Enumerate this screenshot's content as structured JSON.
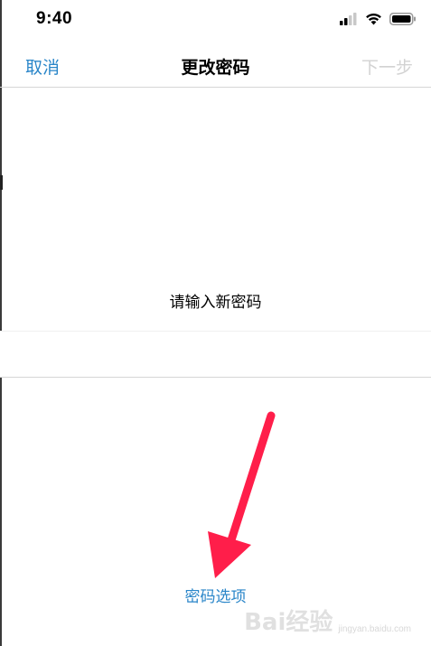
{
  "status_bar": {
    "time": "9:40",
    "icons": [
      "cellular-signal-icon",
      "wifi-icon",
      "battery-icon"
    ]
  },
  "nav": {
    "cancel_label": "取消",
    "title": "更改密码",
    "next_label": "下一步"
  },
  "prompt": "请输入新密码",
  "password_field": {
    "value": ""
  },
  "options_link": "密码选项",
  "annotation": {
    "arrow_color": "#ff1e4a"
  },
  "watermark": {
    "logo": "Bai经验",
    "url": "jingyan.baidu.com"
  },
  "colors": {
    "accent": "#2a86c9",
    "disabled": "#d2d2d2",
    "divider": "#d6d6d6"
  }
}
